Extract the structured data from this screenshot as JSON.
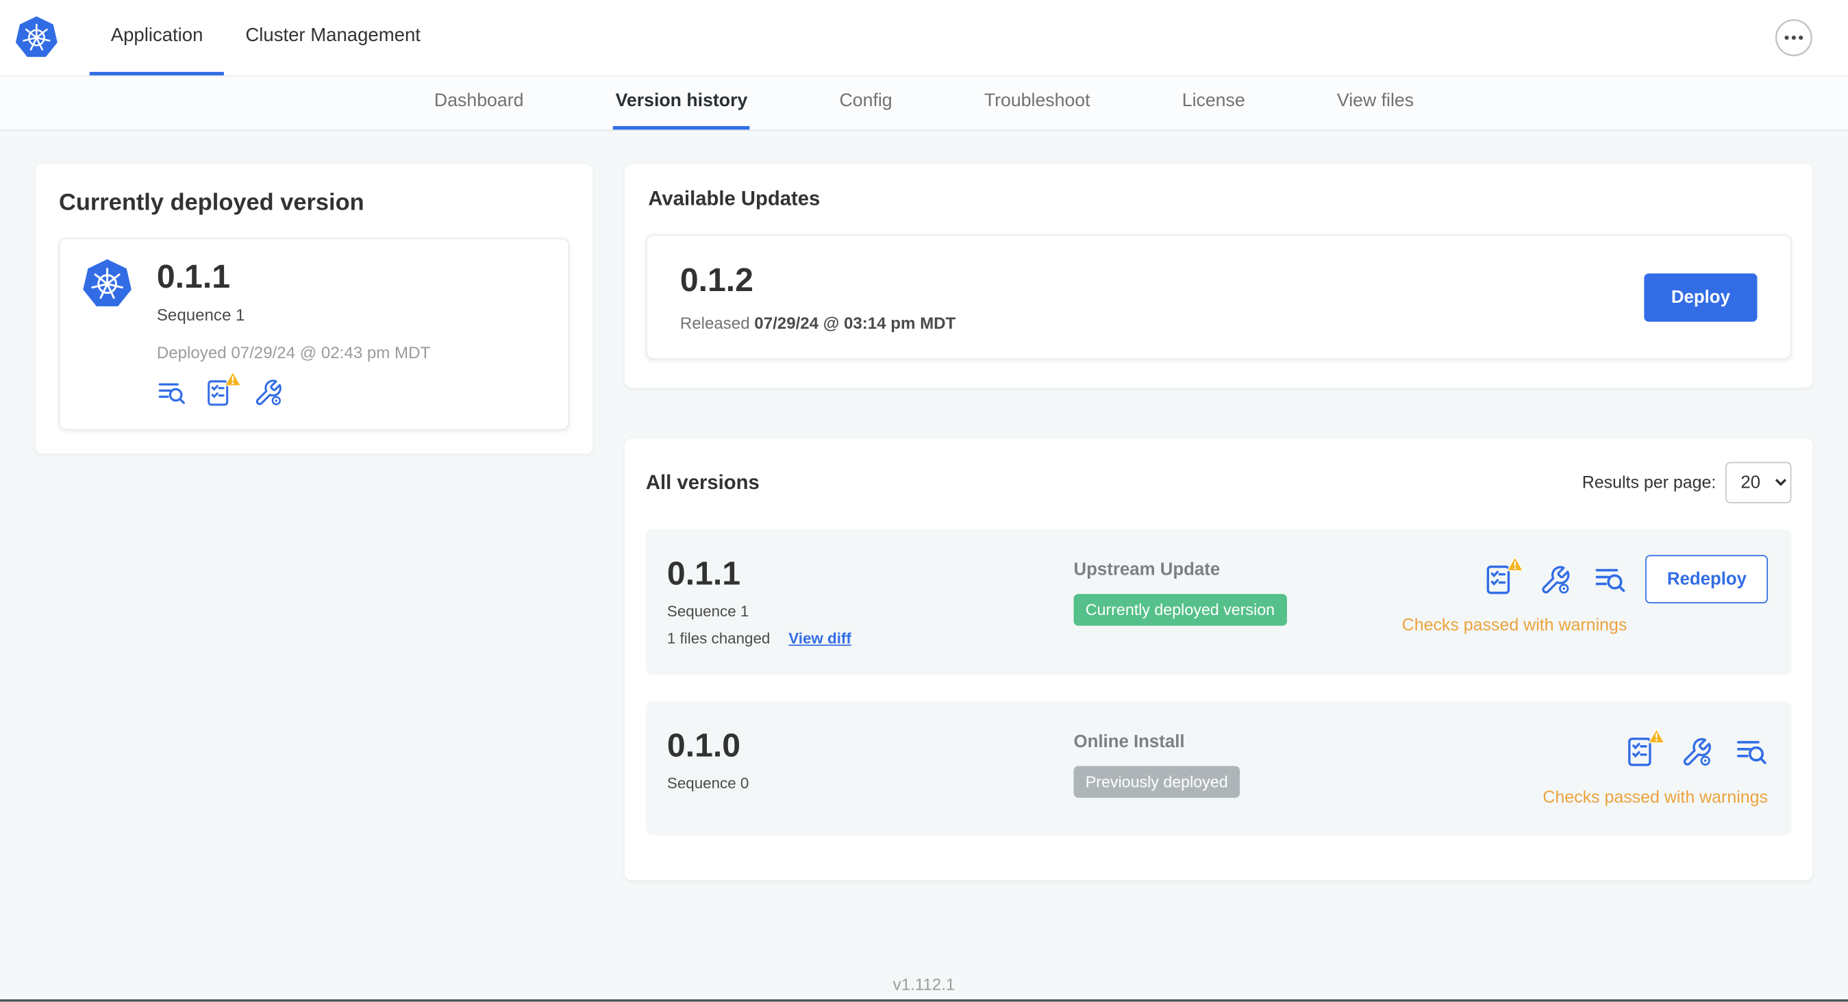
{
  "colors": {
    "primary": "#326DE6",
    "green_badge": "#55C089",
    "gray_badge": "#AEB5B9",
    "warning_text": "#ECA23C",
    "warning_triangle": "#F5B31E"
  },
  "header": {
    "tabs": [
      {
        "label": "Application",
        "active": true
      },
      {
        "label": "Cluster Management",
        "active": false
      }
    ],
    "icons": [
      "kubernetes-logo",
      "overflow-ellipsis-icon"
    ]
  },
  "subnav": {
    "items": [
      {
        "label": "Dashboard",
        "active": false
      },
      {
        "label": "Version history",
        "active": true
      },
      {
        "label": "Config",
        "active": false
      },
      {
        "label": "Troubleshoot",
        "active": false
      },
      {
        "label": "License",
        "active": false
      },
      {
        "label": "View files",
        "active": false
      }
    ]
  },
  "deployed_card": {
    "title": "Currently deployed version",
    "version": "0.1.1",
    "sequence": "Sequence 1",
    "deployed_at": "Deployed 07/29/24 @ 02:43 pm MDT",
    "icons": [
      "deploy-logs-icon",
      "preflight-checks-warning-icon",
      "config-icon"
    ]
  },
  "available_updates": {
    "title": "Available Updates",
    "version": "0.1.2",
    "released_label": "Released",
    "released_at": "07/29/24 @ 03:14 pm MDT",
    "deploy_button": "Deploy"
  },
  "all_versions": {
    "title": "All versions",
    "results_per_page_label": "Results per page:",
    "results_per_page_value": "20",
    "rows": [
      {
        "version": "0.1.1",
        "sequence": "Sequence 1",
        "files_changed": "1 files changed",
        "view_diff": "View diff",
        "source": "Upstream Update",
        "badge": "Currently deployed version",
        "badge_color": "green",
        "status": "Checks passed with warnings",
        "action": "Redeploy",
        "icons": [
          "preflight-checks-warning-icon",
          "config-icon",
          "deploy-logs-icon"
        ]
      },
      {
        "version": "0.1.0",
        "sequence": "Sequence 0",
        "source": "Online Install",
        "badge": "Previously deployed",
        "badge_color": "gray",
        "status": "Checks passed with warnings",
        "icons": [
          "preflight-checks-warning-icon",
          "config-icon",
          "deploy-logs-icon"
        ]
      }
    ]
  },
  "footer": {
    "version": "v1.112.1"
  }
}
